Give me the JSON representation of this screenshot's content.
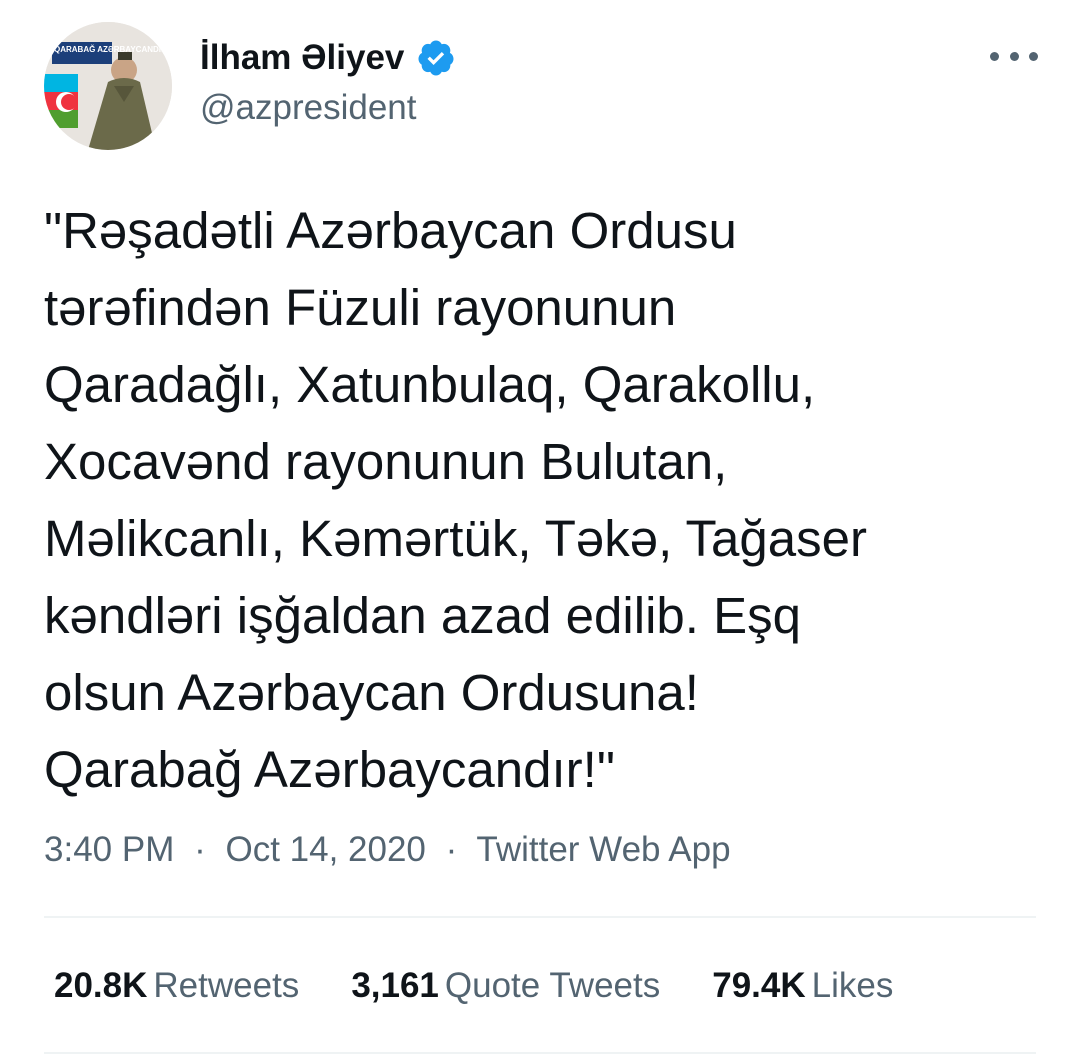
{
  "user": {
    "display_name": "İlham Əliyev",
    "handle": "@azpresident",
    "verified": true,
    "avatar_badge_text": "QARABAĞ AZƏRBAYCANDIR!"
  },
  "tweet": {
    "lines": [
      "\"Rəşadətli Azərbaycan Ordusu",
      "tərəfindən Füzuli rayonunun",
      "Qaradağlı, Xatunbulaq, Qarakollu,",
      "Xocavənd rayonunun Bulutan,",
      "Məlikcanlı, Kəmərtük, Təkə, Tağaser",
      "kəndləri işğaldan azad edilib. Eşq",
      "olsun Azərbaycan Ordusuna!",
      "Qarabağ Azərbaycandır!\""
    ],
    "time": "3:40 PM",
    "date": "Oct 14, 2020",
    "separator": "·",
    "source": "Twitter Web App"
  },
  "stats": [
    {
      "count": "20.8K",
      "label": "Retweets"
    },
    {
      "count": "3,161",
      "label": "Quote Tweets"
    },
    {
      "count": "79.4K",
      "label": "Likes"
    }
  ],
  "icons": {
    "verified": "verified-badge-icon",
    "more": "more-options-icon"
  },
  "colors": {
    "text_primary": "#0f1419",
    "text_secondary": "#536471",
    "verified_blue": "#1d9bf0",
    "divider": "#eff3f4"
  }
}
